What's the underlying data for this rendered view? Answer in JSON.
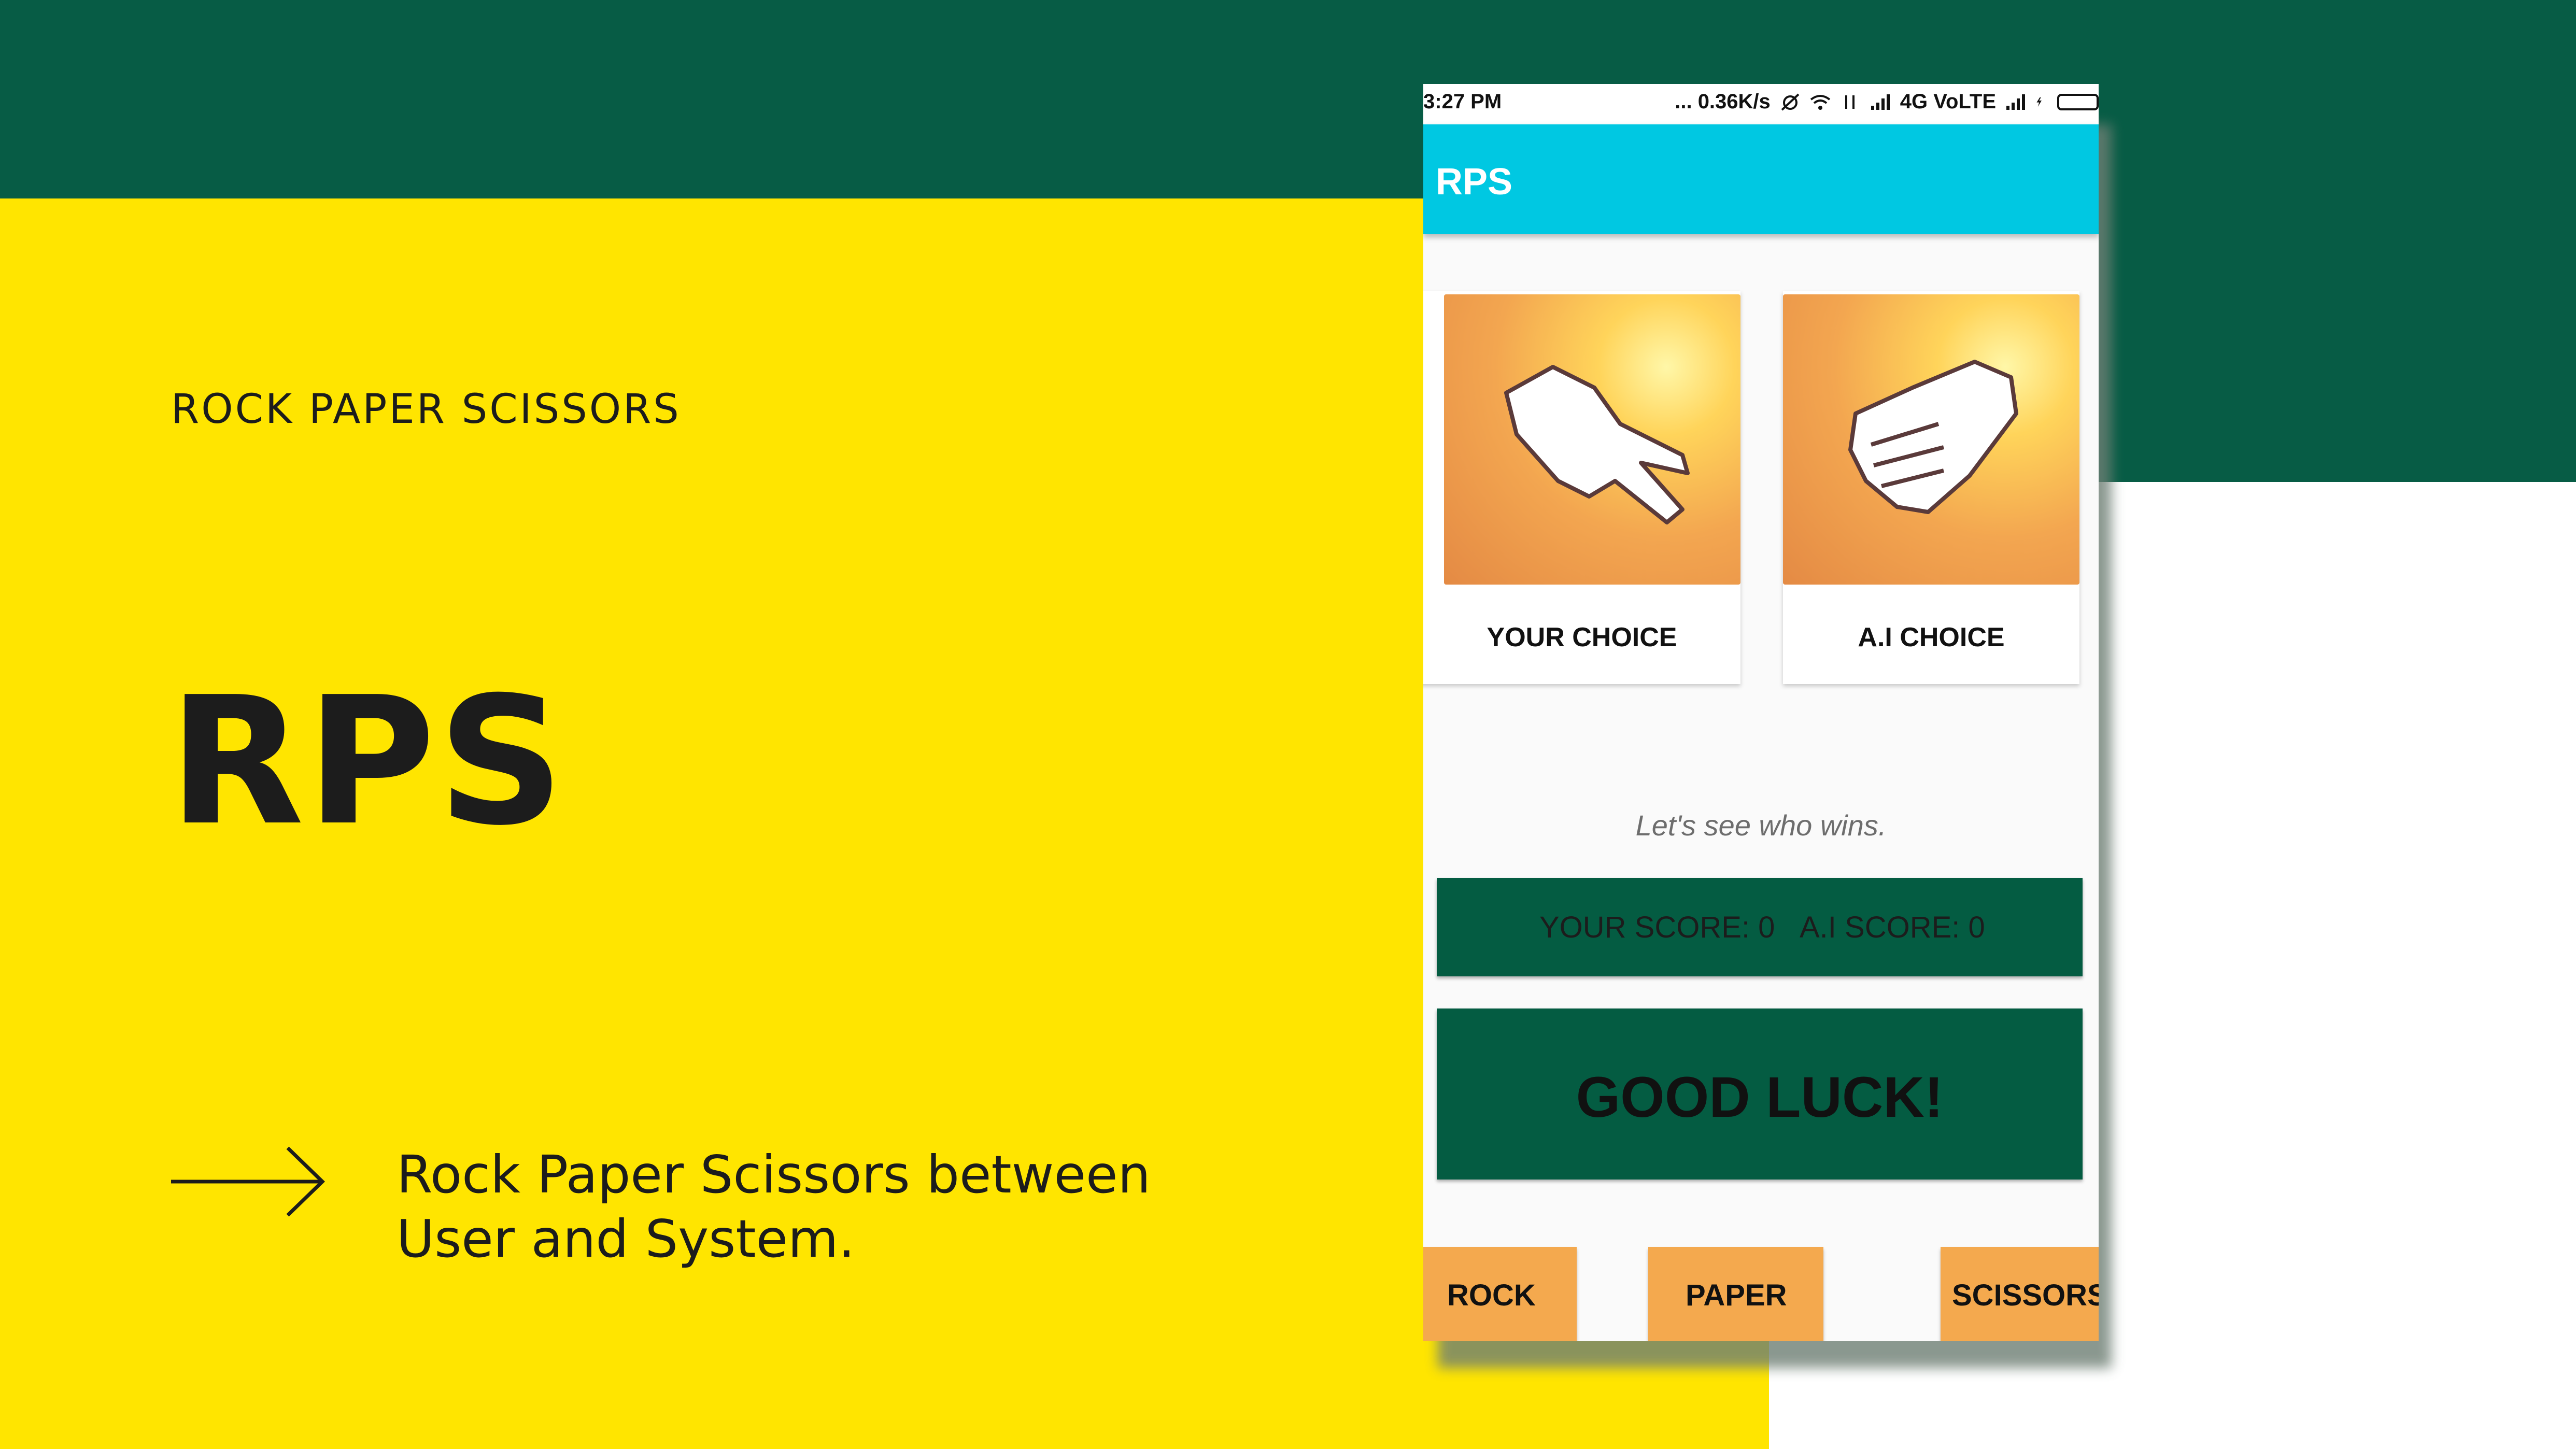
{
  "slide": {
    "eyebrow": "ROCK PAPER SCISSORS",
    "title": "RPS",
    "description_line1": "Rock Paper Scissors between",
    "description_line2": "User and System.",
    "colors": {
      "dark_green": "#075c45",
      "yellow": "#ffe500",
      "text": "#1c1c1c"
    }
  },
  "phone": {
    "statusbar": {
      "time": "3:27 PM",
      "network": "... 0.36K/s",
      "connection": "4G VoLTE"
    },
    "appbar": {
      "title": "RPS",
      "color": "#00c8e2"
    },
    "your_choice": {
      "label": "YOUR CHOICE",
      "gesture": "scissors-hand-icon"
    },
    "ai_choice": {
      "label": "A.I CHOICE",
      "gesture": "rock-fist-icon"
    },
    "status_message": "Let's see who wins.",
    "score": {
      "your_score": "YOUR SCORE: 0",
      "ai_score": "A.I SCORE: 0"
    },
    "result": "GOOD LUCK!",
    "buttons": {
      "rock": "ROCK",
      "paper": "PAPER",
      "scissors": "SCISSORS"
    },
    "accent_colors": {
      "panel_green": "#045c42",
      "button_orange": "#f4a94e"
    }
  }
}
